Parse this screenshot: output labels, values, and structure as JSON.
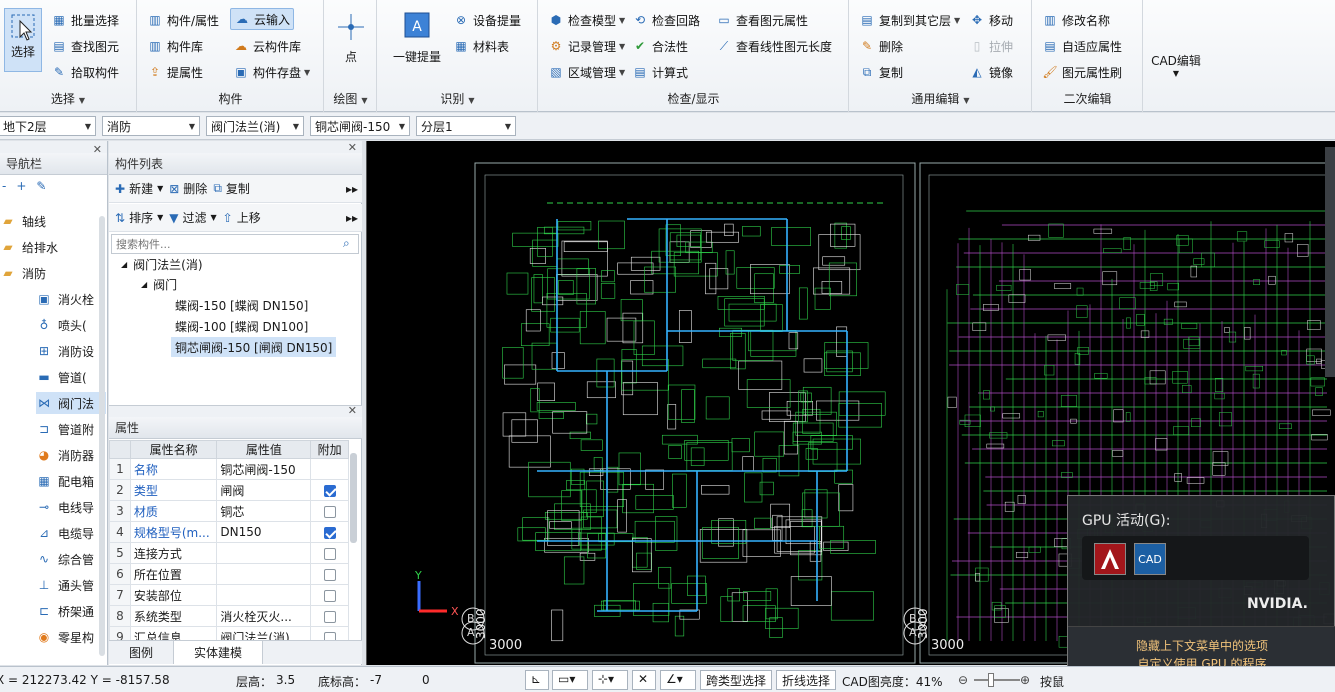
{
  "ribbon": {
    "select_group": {
      "big_label": "选择",
      "label": "选择",
      "items": [
        "批量选择",
        "查找图元",
        "拾取构件"
      ]
    },
    "component_group": {
      "label": "构件",
      "items": [
        "构件/属性",
        "构件库",
        "提属性",
        "云输入",
        "云构件库",
        "构件存盘"
      ]
    },
    "draw_group": {
      "label": "绘图",
      "big_label": "点"
    },
    "identify_group": {
      "label": "识别",
      "big_label": "一键提量",
      "items": [
        "设备提量",
        "材料表"
      ]
    },
    "check_group": {
      "label": "检查/显示",
      "items": [
        "检查模型",
        "检查回路",
        "查看图元属性",
        "记录管理",
        "合法性",
        "查看线性图元长度",
        "区域管理",
        "计算式"
      ]
    },
    "edit_group": {
      "label": "通用编辑",
      "items": [
        "复制到其它层",
        "移动",
        "删除",
        "拉伸",
        "复制",
        "镜像"
      ]
    },
    "second_group": {
      "label": "二次编辑",
      "items": [
        "修改名称",
        "自适应属性",
        "图元属性刷"
      ]
    },
    "cad_group": {
      "label": "CAD编辑"
    }
  },
  "toolbar": {
    "floor": "地下2层",
    "discipline": "消防",
    "type": "阀门法兰(消)",
    "component": "铜芯闸阀-150",
    "sublayer": "分层1"
  },
  "nav": {
    "title": "导航栏",
    "items": [
      "轴线",
      "给排水",
      "消防",
      "消火栓",
      "喷头(",
      "消防设",
      "管道(",
      "阀门法",
      "管道附",
      "消防器",
      "配电箱",
      "电线导",
      "电缆导",
      "综合管",
      "通头管",
      "桥架通",
      "零星构"
    ]
  },
  "component_list": {
    "title": "构件列表",
    "toolbar": [
      "新建",
      "删除",
      "复制",
      "排序",
      "过滤",
      "上移"
    ],
    "search_placeholder": "搜索构件...",
    "tree": {
      "root": "阀门法兰(消)",
      "child": "阀门",
      "leaves": [
        "蝶阀-150 [蝶阀 DN150]",
        "蝶阀-100 [蝶阀 DN100]",
        "铜芯闸阀-150 [闸阀 DN150]"
      ]
    }
  },
  "properties": {
    "title": "属性",
    "headers": [
      "属性名称",
      "属性值",
      "附加"
    ],
    "rows": [
      {
        "idx": "1",
        "name": "名称",
        "value": "铜芯闸阀-150",
        "blue": true,
        "checkbox": false,
        "checked": false
      },
      {
        "idx": "2",
        "name": "类型",
        "value": "闸阀",
        "blue": true,
        "checkbox": true,
        "checked": true
      },
      {
        "idx": "3",
        "name": "材质",
        "value": "铜芯",
        "blue": true,
        "checkbox": true,
        "checked": false
      },
      {
        "idx": "4",
        "name": "规格型号(m...",
        "value": "DN150",
        "blue": true,
        "checkbox": true,
        "checked": true
      },
      {
        "idx": "5",
        "name": "连接方式",
        "value": "",
        "blue": false,
        "checkbox": true,
        "checked": false
      },
      {
        "idx": "6",
        "name": "所在位置",
        "value": "",
        "blue": false,
        "checkbox": true,
        "checked": false
      },
      {
        "idx": "7",
        "name": "安装部位",
        "value": "",
        "blue": false,
        "checkbox": true,
        "checked": false
      },
      {
        "idx": "8",
        "name": "系统类型",
        "value": "消火栓灭火...",
        "blue": false,
        "checkbox": true,
        "checked": false
      },
      {
        "idx": "9",
        "name": "汇总信息",
        "value": "阀门法兰(消)",
        "blue": false,
        "checkbox": true,
        "checked": false
      }
    ],
    "tabs": [
      "图例",
      "实体建模"
    ]
  },
  "canvas": {
    "axis_x": "X",
    "axis_y": "Y",
    "marker_letters": [
      "B",
      "A"
    ],
    "dimension": "3000",
    "dimension_vertical": "3000"
  },
  "status": {
    "coords": "X = 212273.42 Y = -8157.58",
    "floor_height_label": "层高：",
    "floor_height": "3.5",
    "bottom_elev_label": "底标高：",
    "bottom_elev": "-7",
    "extra": "0",
    "btn_cross_select": "跨类型选择",
    "btn_polyline_select": "折线选择",
    "cad_brightness": "CAD图亮度：41%",
    "tail": "按鼠"
  },
  "gpu": {
    "title": "GPU 活动(G):",
    "brand": "NVIDIA.",
    "footer_line1": "隐藏上下文菜单中的选项",
    "footer_line2": "自定义使用 GPU 的程序",
    "app2_label": "CAD"
  },
  "colors": {
    "accent": "#2a6bb5",
    "selection": "#cfe2f7",
    "cad_green": "#2fd04a",
    "cad_cyan": "#34b3ff",
    "cad_magenta": "#b04cc4",
    "cad_bg": "#000000"
  }
}
